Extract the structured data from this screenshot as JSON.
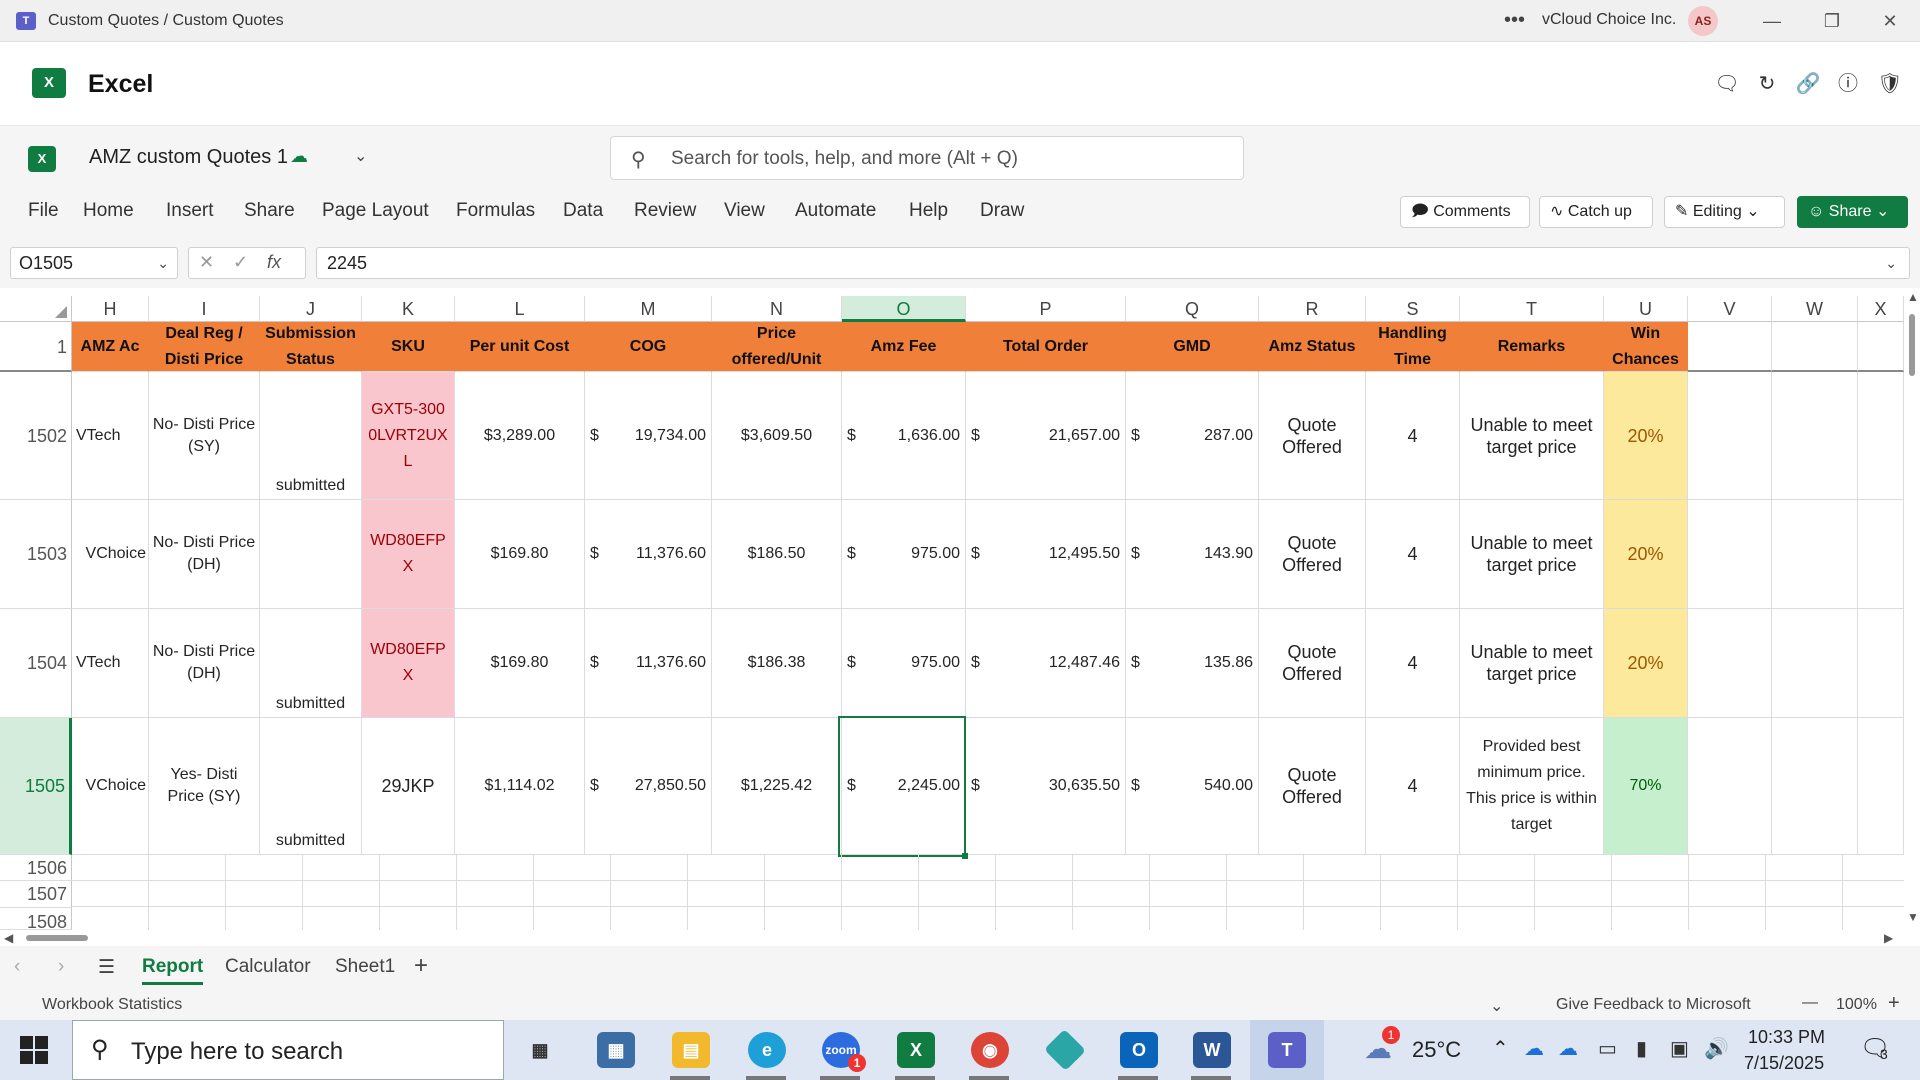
{
  "window": {
    "title": "Custom Quotes / Custom Quotes",
    "org": "vCloud Choice Inc.",
    "avatar": "AS",
    "app_icon_letter": "T"
  },
  "app": {
    "name": "Excel",
    "logo_letter": "X"
  },
  "doc": {
    "name": "AMZ custom Quotes 1",
    "search_placeholder": "Search for tools, help, and more (Alt + Q)"
  },
  "ribbon": {
    "tabs": [
      "File",
      "Home",
      "Insert",
      "Share",
      "Page Layout",
      "Formulas",
      "Data",
      "Review",
      "View",
      "Automate",
      "Help",
      "Draw"
    ],
    "comments": "Comments",
    "catchup": "Catch up",
    "editing": "Editing",
    "share": "Share"
  },
  "formula": {
    "namebox": "O1505",
    "fx": "fx",
    "value": "2245"
  },
  "columns": [
    "H",
    "I",
    "J",
    "K",
    "L",
    "M",
    "N",
    "O",
    "P",
    "Q",
    "R",
    "S",
    "T",
    "U",
    "V",
    "W",
    "X"
  ],
  "header_row": {
    "row_num": "1",
    "labels": [
      "AMZ Ac",
      "Deal Reg / Disti Price",
      "Submission Status",
      "SKU",
      "Per unit Cost",
      "COG",
      "Price offered/Unit",
      "Amz Fee",
      "Total Order",
      "GMD",
      "Amz Status",
      "Handling Time",
      "Remarks",
      "Win Chances"
    ]
  },
  "rows": [
    {
      "num": "1502",
      "acct": "VTech",
      "deal": "No- Disti Price (SY)",
      "status": "submitted",
      "sku": "GXT5-3000LVRT2UXL",
      "cost": "$3,289.00",
      "cog": "19,734.00",
      "price": "$3,609.50",
      "fee": "1,636.00",
      "total": "21,657.00",
      "gmd": "287.00",
      "amz_status": "Quote Offered",
      "handling": "4",
      "remarks": "Unable to meet target price",
      "win": "20%"
    },
    {
      "num": "1503",
      "acct": "VChoice",
      "deal": "No- Disti Price (DH)",
      "status": "",
      "sku": "WD80EFPX",
      "cost": "$169.80",
      "cog": "11,376.60",
      "price": "$186.50",
      "fee": "975.00",
      "total": "12,495.50",
      "gmd": "143.90",
      "amz_status": "Quote Offered",
      "handling": "4",
      "remarks": "Unable to meet target price",
      "win": "20%"
    },
    {
      "num": "1504",
      "acct": "VTech",
      "deal": "No- Disti Price (DH)",
      "status": "submitted",
      "sku": "WD80EFPX",
      "cost": "$169.80",
      "cog": "11,376.60",
      "price": "$186.38",
      "fee": "975.00",
      "total": "12,487.46",
      "gmd": "135.86",
      "amz_status": "Quote Offered",
      "handling": "4",
      "remarks": "Unable to meet target price",
      "win": "20%"
    },
    {
      "num": "1505",
      "acct": "VChoice",
      "deal": "Yes- Disti Price (SY)",
      "status": "submitted",
      "sku": "29JKP",
      "cost": "$1,114.02",
      "cog": "27,850.50",
      "price": "$1,225.42",
      "fee": "2,245.00",
      "total": "30,635.50",
      "gmd": "540.00",
      "amz_status": "Quote Offered",
      "handling": "4",
      "remarks": "Provided best minimum price. This price is within target",
      "win": "70%"
    }
  ],
  "empty_rows": [
    "1506",
    "1507",
    "1508"
  ],
  "currency_symbol": "$",
  "sheets": [
    "Report",
    "Calculator",
    "Sheet1"
  ],
  "status": {
    "left": "Workbook Statistics",
    "feedback": "Give Feedback to Microsoft",
    "zoom": "100%"
  },
  "taskbar": {
    "search": "Type here to search",
    "weather": "25°C",
    "time": "10:33 PM",
    "date": "7/15/2025",
    "zoom_badge": "1",
    "weather_badge": "1",
    "notif_count": "3"
  },
  "colors": {
    "header_orange": "#f07f3a",
    "excel_green": "#107c41",
    "pink": "#f8c6cc",
    "yellow": "#fde99b",
    "green": "#c6efce"
  }
}
